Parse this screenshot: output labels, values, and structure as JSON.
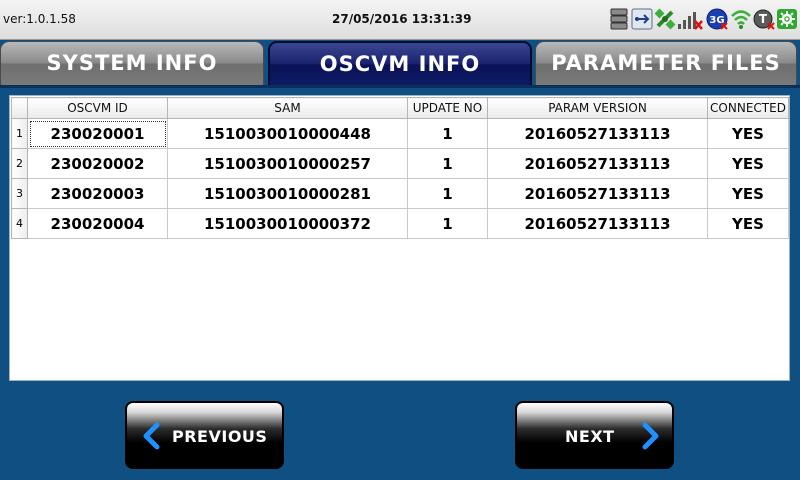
{
  "status_bar": {
    "version": "ver:1.0.1.58",
    "datetime": "27/05/2016 13:31:39",
    "icons": [
      "storage-icon",
      "usb-icon",
      "gps-icon",
      "signal-icon",
      "network-3g-icon",
      "wifi-icon",
      "terminal-icon",
      "settings-cog-icon"
    ],
    "badge_3g": "3G",
    "badge_t": "T"
  },
  "tabs": [
    {
      "label": "SYSTEM INFO",
      "active": false
    },
    {
      "label": "OSCVM INFO",
      "active": true
    },
    {
      "label": "PARAMETER FILES",
      "active": false
    }
  ],
  "table": {
    "columns": [
      "OSCVM ID",
      "SAM",
      "UPDATE NO",
      "PARAM VERSION",
      "CONNECTED"
    ],
    "rows": [
      {
        "num": "1",
        "oscvm_id": "230020001",
        "sam": "1510030010000448",
        "update_no": "1",
        "param_version": "20160527133113",
        "connected": "YES"
      },
      {
        "num": "2",
        "oscvm_id": "230020002",
        "sam": "1510030010000257",
        "update_no": "1",
        "param_version": "20160527133113",
        "connected": "YES"
      },
      {
        "num": "3",
        "oscvm_id": "230020003",
        "sam": "1510030010000281",
        "update_no": "1",
        "param_version": "20160527133113",
        "connected": "YES"
      },
      {
        "num": "4",
        "oscvm_id": "230020004",
        "sam": "1510030010000372",
        "update_no": "1",
        "param_version": "20160527133113",
        "connected": "YES"
      }
    ]
  },
  "buttons": {
    "previous": "PREVIOUS",
    "next": "NEXT"
  },
  "colors": {
    "background": "#0f4f82",
    "active_tab": "#0d1a66",
    "inactive_tab": "#8a8a8a",
    "arrow": "#1e90ff"
  }
}
